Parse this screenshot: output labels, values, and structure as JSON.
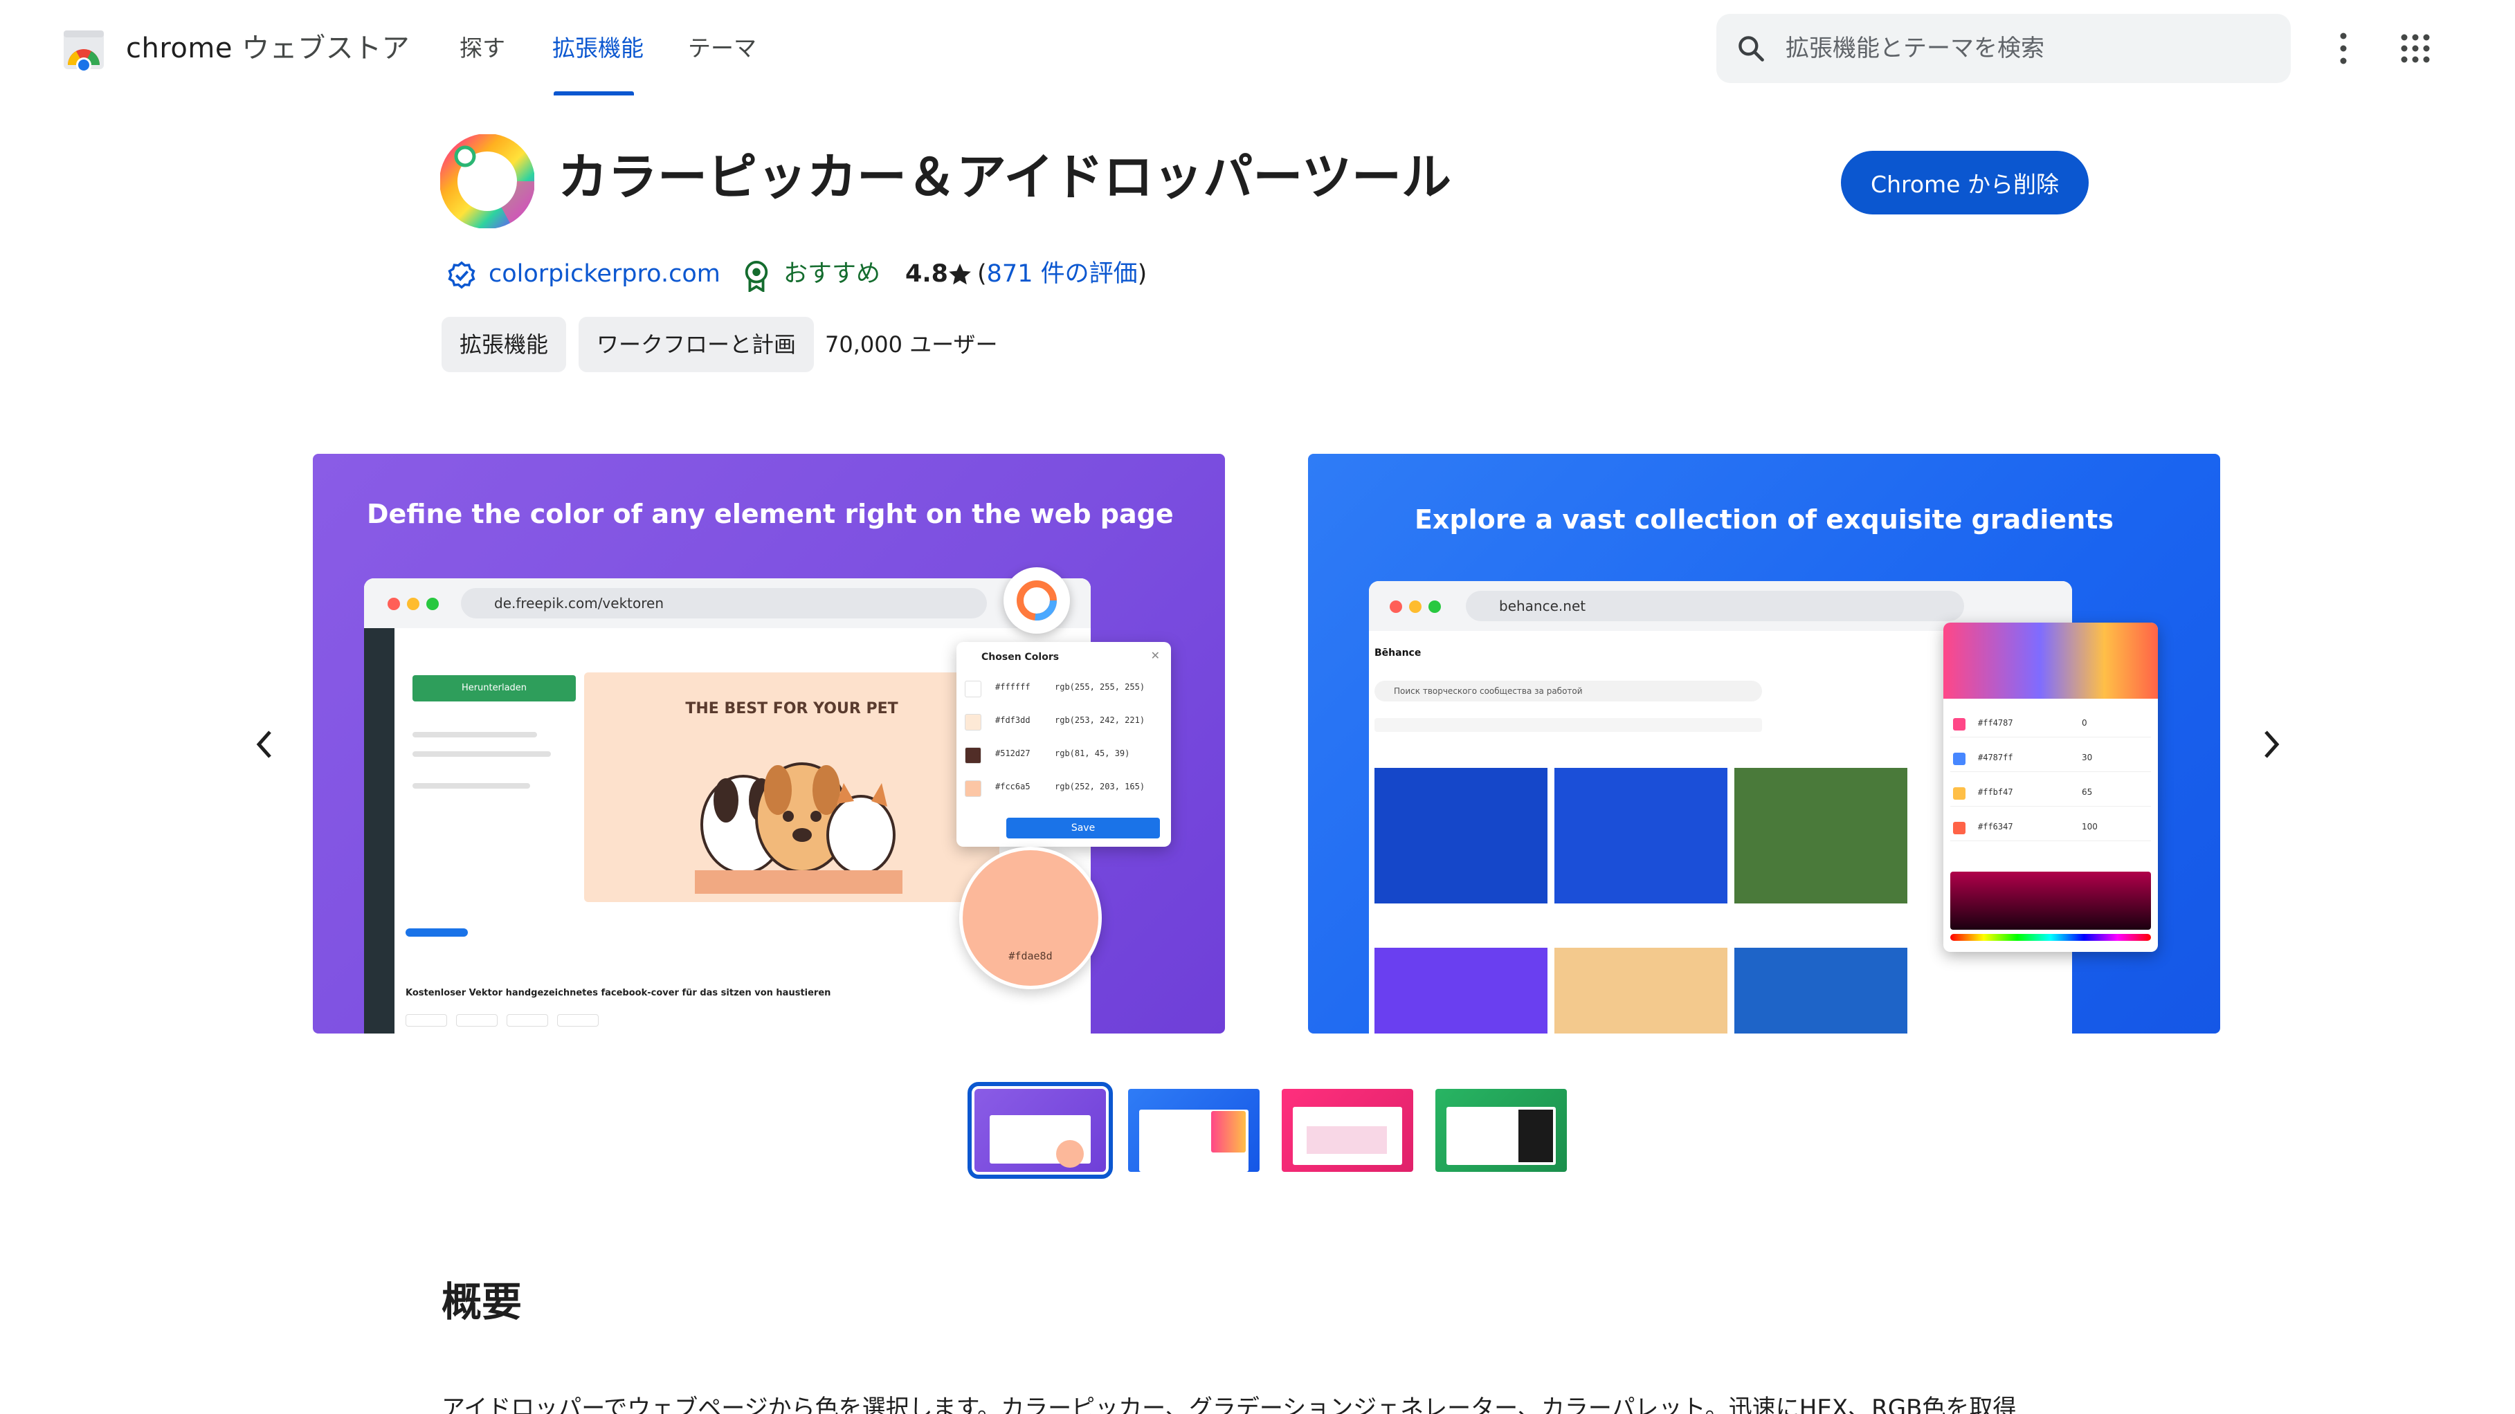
{
  "header": {
    "brand_name": "chrome",
    "brand_store": "ウェブストア",
    "nav": [
      "探す",
      "拡張機能",
      "テーマ"
    ],
    "active_nav": "拡張機能",
    "search_placeholder": "拡張機能とテーマを検索"
  },
  "extension": {
    "title": "カラーピッカー＆アイドロッパーツール",
    "action_button": "Chrome から削除",
    "publisher": "colorpickerpro.com",
    "featured_label": "おすすめ",
    "rating": "4.8",
    "reviews_open": "(",
    "reviews_link": "871 件の評価",
    "reviews_close": ")",
    "chips": [
      "拡張機能",
      "ワークフローと計画"
    ],
    "users": "70,000 ユーザー"
  },
  "carousel": {
    "slide1": {
      "caption": "Define the color of any element right on the web page",
      "url": "de.freepik.com/vektoren",
      "download_button": "Herunterladen",
      "banner_text": "THE BEST FOR YOUR PET",
      "panel_title": "Chosen Colors",
      "colors": [
        {
          "hex": "#ffffff",
          "rgb": "rgb(255, 255, 255)",
          "swatch": "#ffffff"
        },
        {
          "hex": "#fdf3dd",
          "rgb": "rgb(253, 242, 221)",
          "swatch": "#fde9d6"
        },
        {
          "hex": "#512d27",
          "rgb": "rgb(81, 45, 39)",
          "swatch": "#512d27"
        },
        {
          "hex": "#fcc6a5",
          "rgb": "rgb(252, 203, 165)",
          "swatch": "#fcc6a5"
        }
      ],
      "save_label": "Save",
      "picked_hex": "#fdae8d",
      "page_text": "Kostenloser Vektor handgezeichnetes facebook-cover für das sitzen von haustieren"
    },
    "slide2": {
      "caption": "Explore a vast collection of exquisite gradients",
      "url": "behance.net",
      "site_name": "Bēhance",
      "search_text": "Поиск творческого сообщества за работой",
      "gradient_rows": [
        {
          "hex": "#ff4787",
          "val": "0",
          "swatch": "#ff4787"
        },
        {
          "hex": "#4787ff",
          "val": "30",
          "swatch": "#4787ff"
        },
        {
          "hex": "#ffbf47",
          "val": "65",
          "swatch": "#ffbf47"
        },
        {
          "hex": "#ff6347",
          "val": "100",
          "swatch": "#ff6347"
        }
      ]
    }
  },
  "overview": {
    "title": "概要",
    "text": "アイドロッパーでウェブページから色を選択します。カラーピッカー、グラデーションジェネレーター、カラーパレット。迅速にHEX、RGB色を取得"
  },
  "colors": {
    "accent": "#0b57d0",
    "featured": "#146c2e"
  }
}
